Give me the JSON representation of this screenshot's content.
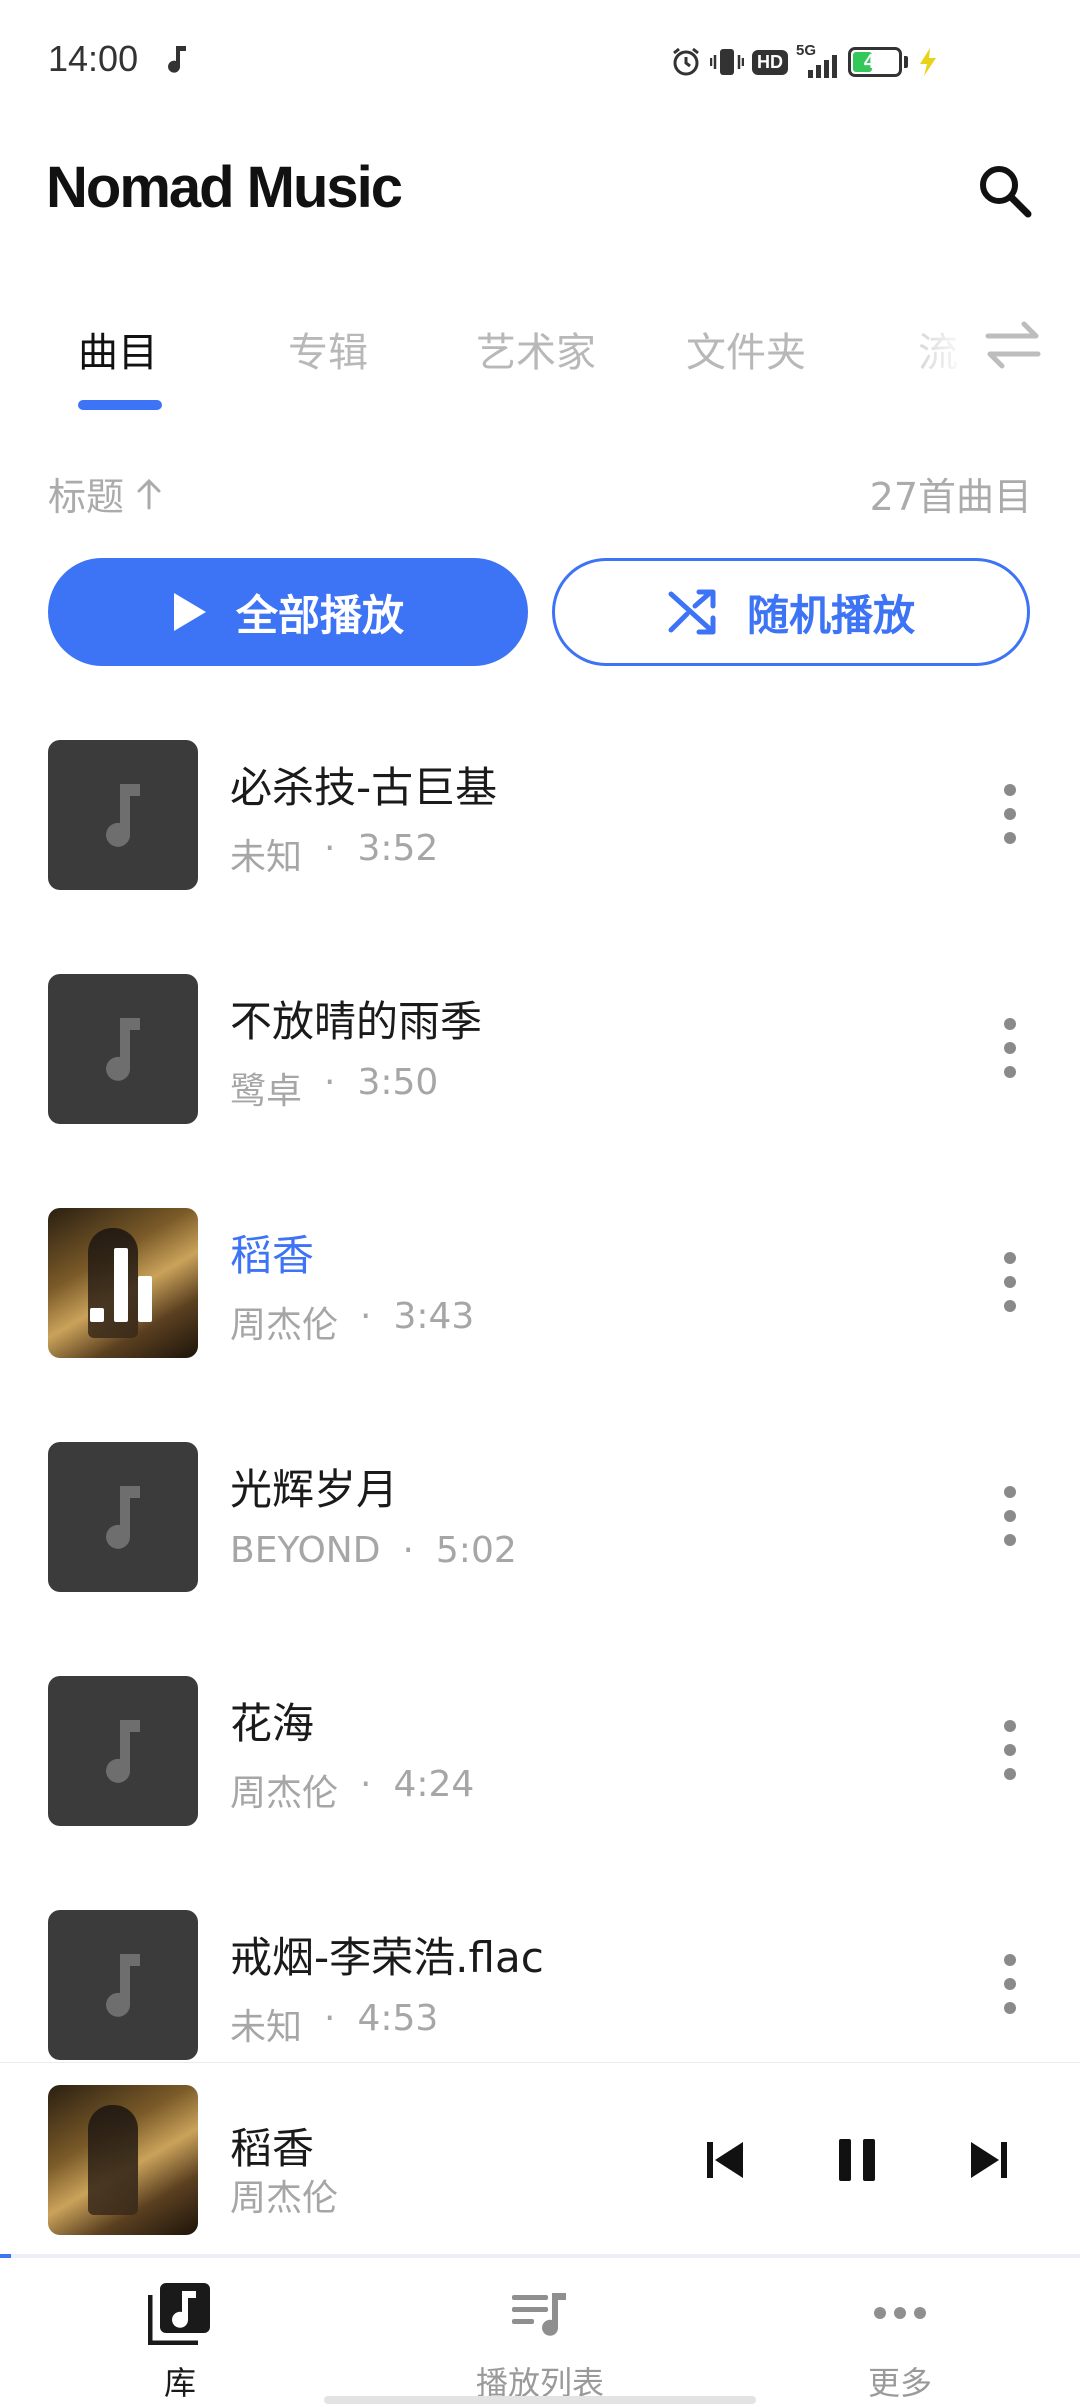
{
  "status_bar": {
    "time": "14:00",
    "network": "5G",
    "hd": "HD",
    "battery": "48",
    "battery_level": 0.48
  },
  "header": {
    "title": "Nomad Music"
  },
  "tabs": [
    {
      "label": "曲目",
      "active": true
    },
    {
      "label": "专辑",
      "active": false
    },
    {
      "label": "艺术家",
      "active": false
    },
    {
      "label": "文件夹",
      "active": false
    },
    {
      "label": "流",
      "active": false
    }
  ],
  "sort": {
    "label": "标题",
    "count_text": "27首曲目"
  },
  "actions": {
    "play_all": "全部播放",
    "shuffle": "随机播放"
  },
  "songs": [
    {
      "title": "必杀技-古巨基",
      "artist": "未知",
      "duration": "3:52",
      "playing": false
    },
    {
      "title": "不放晴的雨季",
      "artist": "鹭卓",
      "duration": "3:50",
      "playing": false
    },
    {
      "title": "稻香",
      "artist": "周杰伦",
      "duration": "3:43",
      "playing": true
    },
    {
      "title": "光辉岁月",
      "artist": "BEYOND",
      "duration": "5:02",
      "playing": false
    },
    {
      "title": "花海",
      "artist": "周杰伦",
      "duration": "4:24",
      "playing": false
    },
    {
      "title": "戒烟-李荣浩.flac",
      "artist": "未知",
      "duration": "4:53",
      "playing": false
    }
  ],
  "meta_separator": "·",
  "now_playing": {
    "title": "稻香",
    "artist": "周杰伦",
    "progress": 0.01
  },
  "bottom_nav": [
    {
      "label": "库",
      "icon": "library-icon",
      "active": true
    },
    {
      "label": "播放列表",
      "icon": "playlist-icon",
      "active": false
    },
    {
      "label": "更多",
      "icon": "more-icon",
      "active": false
    }
  ],
  "colors": {
    "accent": "#3d73f5",
    "placeholder_cover": "#3b3b3b",
    "secondary_text": "#a6a6a6"
  }
}
